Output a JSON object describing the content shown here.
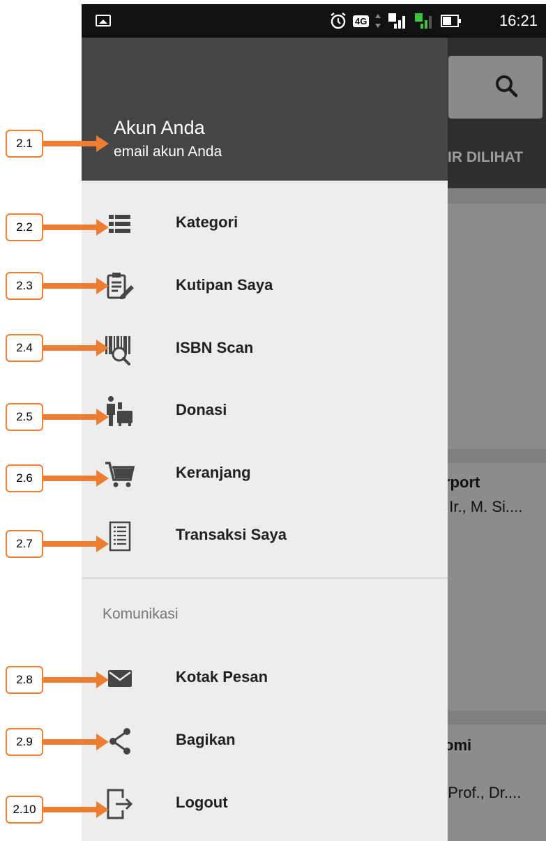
{
  "status_bar": {
    "time": "16:21",
    "network_label": "4G",
    "sim1": "1",
    "sim2": "2"
  },
  "background": {
    "tab_label": "IR DILIHAT",
    "card1_title": "rport",
    "card1_author": ", Ir., M. Si....",
    "card2_title": "omi",
    "card2_author": ", Prof., Dr...."
  },
  "drawer": {
    "account_name": "Akun Anda",
    "account_email": "email akun Anda",
    "items": [
      {
        "label": "Kategori",
        "icon": "list-icon"
      },
      {
        "label": "Kutipan Saya",
        "icon": "clipboard-pencil-icon"
      },
      {
        "label": "ISBN Scan",
        "icon": "barcode-scan-icon"
      },
      {
        "label": "Donasi",
        "icon": "donate-icon"
      },
      {
        "label": "Keranjang",
        "icon": "cart-icon"
      },
      {
        "label": "Transaksi Saya",
        "icon": "transaction-list-icon"
      }
    ],
    "section_title": "Komunikasi",
    "comm_items": [
      {
        "label": "Kotak Pesan",
        "icon": "mail-icon"
      },
      {
        "label": "Bagikan",
        "icon": "share-icon"
      },
      {
        "label": "Logout",
        "icon": "logout-icon"
      }
    ]
  },
  "annotations": [
    "2.1",
    "2.2",
    "2.3",
    "2.4",
    "2.5",
    "2.6",
    "2.7",
    "2.8",
    "2.9",
    "2.10"
  ],
  "colors": {
    "annotation_accent": "#ed7d31",
    "drawer_header": "#454545",
    "drawer_bg": "#ededed",
    "status_bar": "#111111"
  }
}
